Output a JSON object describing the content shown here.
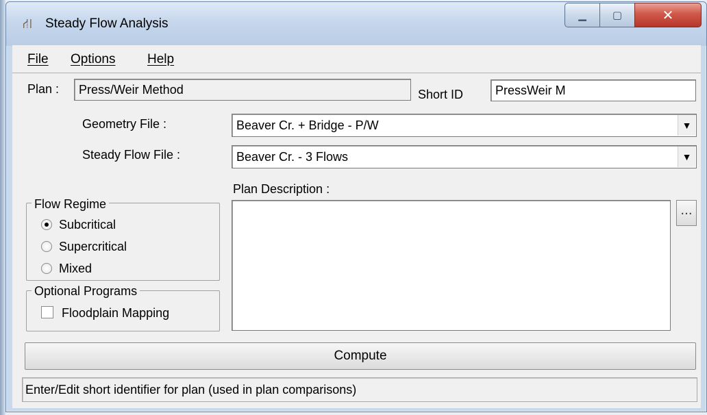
{
  "window": {
    "title": "Steady Flow Analysis"
  },
  "menu": {
    "file": "File",
    "options": "Options",
    "help": "Help"
  },
  "plan": {
    "label": "Plan :",
    "value": "Press/Weir Method"
  },
  "short_id": {
    "label": "Short ID",
    "value": "PressWeir M"
  },
  "geometry": {
    "label": "Geometry File :",
    "value": "Beaver Cr. + Bridge - P/W"
  },
  "steady_flow": {
    "label": "Steady Flow File :",
    "value": "Beaver Cr. - 3 Flows"
  },
  "description": {
    "label": "Plan Description :",
    "value": "",
    "button_label": "..."
  },
  "flow_regime": {
    "title": "Flow Regime",
    "options": [
      "Subcritical",
      "Supercritical",
      "Mixed"
    ],
    "selected": "Subcritical"
  },
  "optional_programs": {
    "title": "Optional Programs",
    "floodplain_label": "Floodplain Mapping",
    "floodplain_checked": false
  },
  "compute": {
    "label": "Compute"
  },
  "status": {
    "text": "Enter/Edit short identifier for plan (used in plan comparisons)"
  },
  "icons": {
    "app": "app-icon",
    "minimize": "minimize-icon",
    "maximize": "maximize-icon",
    "close": "close-icon",
    "dropdown": "chevron-down-icon"
  },
  "colors": {
    "close_button": "#c8463a",
    "title_bar": "#c6d7ec",
    "client_bg": "#f0f0f0"
  }
}
